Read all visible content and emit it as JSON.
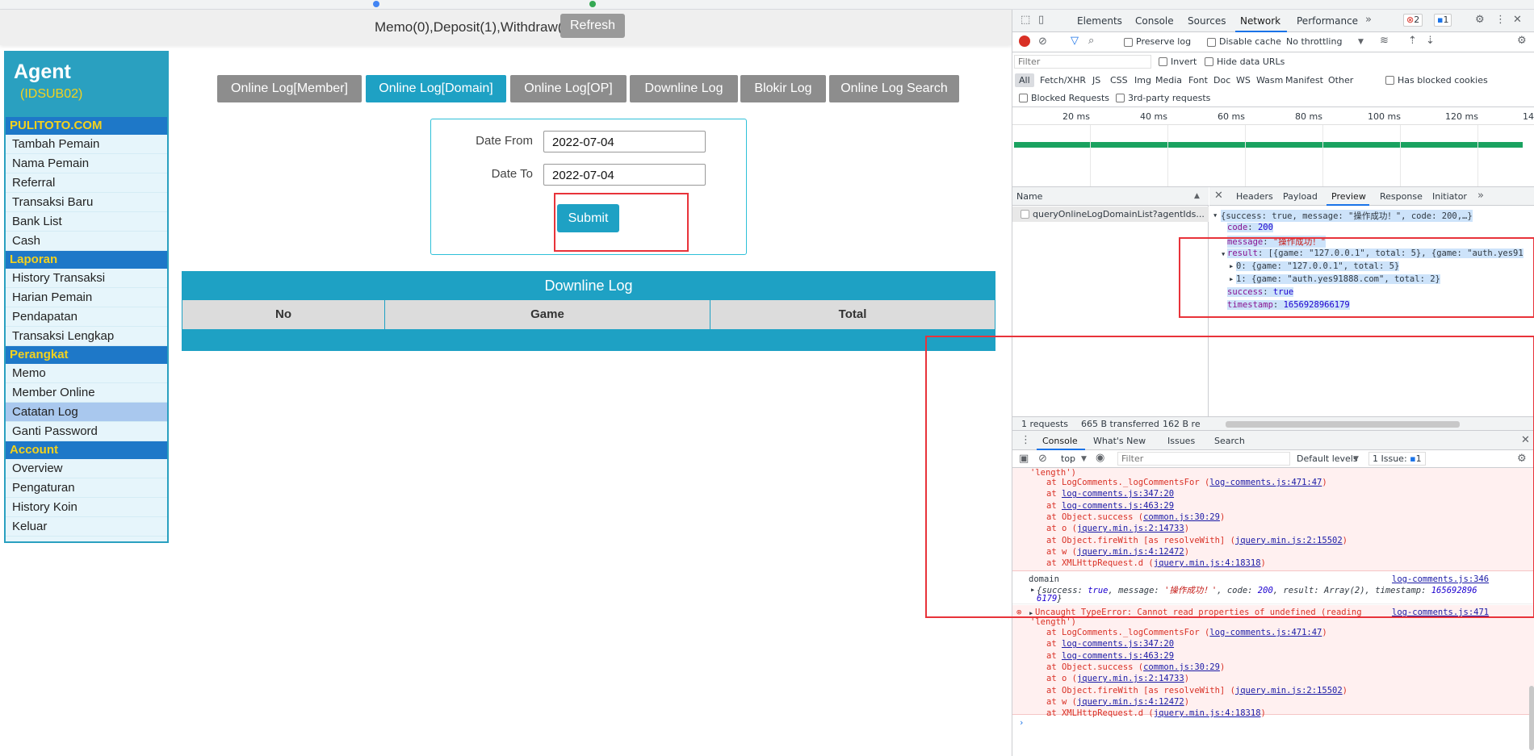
{
  "colors": {
    "accent": "#1ea1c4",
    "sidebar_section": "#1e78c8",
    "section_text": "#f5d21c",
    "highlight_red": "#e8333a",
    "tab_inactive": "#8d8d8d"
  },
  "topbar": {
    "memo": "Memo(0),Deposit(1),Withdraw(0)",
    "refresh_label": "Refresh"
  },
  "sidebar": {
    "title": "Agent",
    "agent_code": "(IDSUB02)",
    "sections": [
      {
        "label": "PULITOTO.COM",
        "items": [
          "Tambah Pemain",
          "Nama Pemain",
          "Referral",
          "Transaksi Baru",
          "Bank List",
          "Cash"
        ]
      },
      {
        "label": "Laporan",
        "items": [
          "History Transaksi",
          "Harian Pemain",
          "Pendapatan",
          "Transaksi Lengkap"
        ]
      },
      {
        "label": "Perangkat",
        "items": [
          "Memo",
          "Member Online",
          "Catatan Log",
          "Ganti Password"
        ]
      },
      {
        "label": "Account",
        "items": [
          "Overview",
          "Pengaturan",
          "History Koin",
          "Keluar"
        ]
      }
    ],
    "active_item": "Catatan Log"
  },
  "tabs": [
    "Online Log[Member]",
    "Online Log[Domain]",
    "Online Log[OP]",
    "Downline Log",
    "Blokir Log",
    "Online Log Search"
  ],
  "active_tab": "Online Log[Domain]",
  "form": {
    "date_from_label": "Date From",
    "date_from": "2022-07-04",
    "date_to_label": "Date To",
    "date_to": "2022-07-04",
    "submit_label": "Submit"
  },
  "downline": {
    "title": "Downline Log",
    "columns": [
      "No",
      "Game",
      "Total"
    ]
  },
  "devtools": {
    "main_tabs": [
      "Elements",
      "Console",
      "Sources",
      "Network",
      "Performance"
    ],
    "active_main_tab": "Network",
    "error_count": "2",
    "info_count": "1",
    "toolbar": {
      "preserve_log": "Preserve log",
      "disable_cache": "Disable cache",
      "throttling": "No throttling"
    },
    "filter_placeholder": "Filter",
    "invert": "Invert",
    "hide_data_urls": "Hide data URLs",
    "type_filters": [
      "All",
      "Fetch/XHR",
      "JS",
      "CSS",
      "Img",
      "Media",
      "Font",
      "Doc",
      "WS",
      "Wasm",
      "Manifest",
      "Other"
    ],
    "has_blocked_cookies": "Has blocked cookies",
    "blocked_requests": "Blocked Requests",
    "third_party": "3rd-party requests",
    "timeline_ticks": [
      "20 ms",
      "40 ms",
      "60 ms",
      "80 ms",
      "100 ms",
      "120 ms",
      "14"
    ],
    "name_header": "Name",
    "request_name": "queryOnlineLogDomainList?agentIds...",
    "detail_tabs": [
      "Headers",
      "Payload",
      "Preview",
      "Response",
      "Initiator"
    ],
    "active_detail_tab": "Preview",
    "preview": {
      "summary": "{success: true, message: \"操作成功！\", code: 200,…}",
      "code_key": "code",
      "code_val": "200",
      "message_key": "message",
      "message_val": "\"操作成功！\"",
      "result_key": "result",
      "result_val": "[{game: \"127.0.0.1\", total: 5}, {game: \"auth.yes91",
      "item0": "0: {game: \"127.0.0.1\", total: 5}",
      "item1": "1: {game: \"auth.yes91888.com\", total: 2}",
      "success_key": "success",
      "success_val": "true",
      "timestamp_key": "timestamp",
      "timestamp_val": "1656928966179"
    },
    "status_bar": [
      "1 requests",
      "665 B transferred",
      "162 B re"
    ],
    "drawer_tabs": [
      "Console",
      "What's New",
      "Issues",
      "Search"
    ],
    "console_toolbar": {
      "context": "top",
      "filter_placeholder": "Filter",
      "levels": "Default levels",
      "issues": "1 Issue:",
      "issues_count": "1"
    },
    "console_lines": {
      "first_tail": "'length')",
      "stack1": [
        {
          "fn": "at LogComments._logCommentsFor (",
          "loc": "log-comments.js:471:47",
          "end": ")"
        },
        {
          "fn": "at ",
          "loc": "log-comments.js:347:20",
          "end": ""
        },
        {
          "fn": "at ",
          "loc": "log-comments.js:463:29",
          "end": ""
        },
        {
          "fn": "at Object.success (",
          "loc": "common.js:30:29",
          "end": ")"
        },
        {
          "fn": "at o (",
          "loc": "jquery.min.js:2:14733",
          "end": ")"
        },
        {
          "fn": "at Object.fireWith [as resolveWith] (",
          "loc": "jquery.min.js:2:15502",
          "end": ")"
        },
        {
          "fn": "at w (",
          "loc": "jquery.min.js:4:12472",
          "end": ")"
        },
        {
          "fn": "at XMLHttpRequest.d (",
          "loc": "jquery.min.js:4:18318",
          "end": ")"
        }
      ],
      "log_label": "domain",
      "log_source": "log-comments.js:346",
      "log_obj_pre": "{success: ",
      "log_obj_true": "true",
      "log_obj_mid": ", message: ",
      "log_obj_msg": "'操作成功！'",
      "log_obj_code_pre": ", code: ",
      "log_obj_code": "200",
      "log_obj_result": ", result: Array(2), timestamp: ",
      "log_obj_ts1": "165692896",
      "log_obj_ts2": "6179",
      "log_obj_end": "}",
      "error_text": "Uncaught TypeError: Cannot read properties of undefined (reading",
      "error_source": "log-comments.js:471",
      "error_tail": "'length')"
    }
  }
}
